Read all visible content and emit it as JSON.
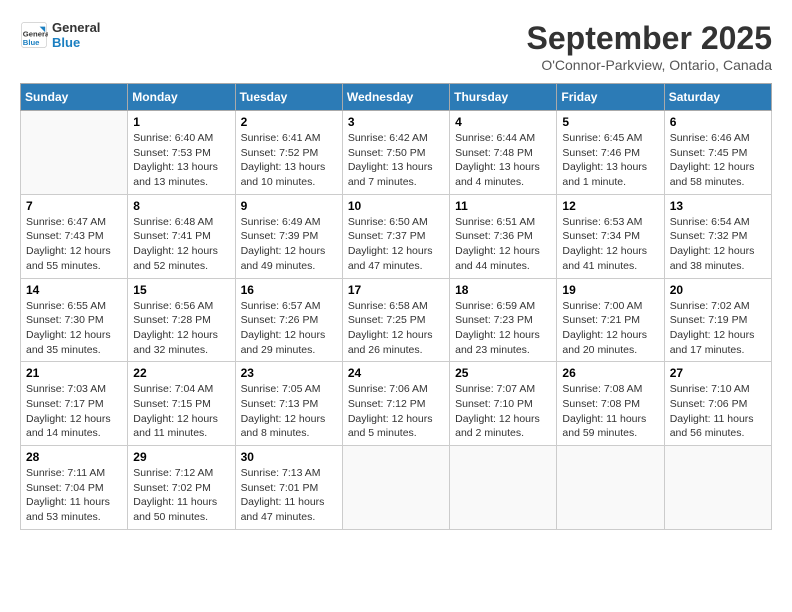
{
  "header": {
    "logo_line1": "General",
    "logo_line2": "Blue",
    "month_title": "September 2025",
    "subtitle": "O'Connor-Parkview, Ontario, Canada"
  },
  "days_of_week": [
    "Sunday",
    "Monday",
    "Tuesday",
    "Wednesday",
    "Thursday",
    "Friday",
    "Saturday"
  ],
  "weeks": [
    [
      {
        "day": "",
        "info": ""
      },
      {
        "day": "1",
        "info": "Sunrise: 6:40 AM\nSunset: 7:53 PM\nDaylight: 13 hours\nand 13 minutes."
      },
      {
        "day": "2",
        "info": "Sunrise: 6:41 AM\nSunset: 7:52 PM\nDaylight: 13 hours\nand 10 minutes."
      },
      {
        "day": "3",
        "info": "Sunrise: 6:42 AM\nSunset: 7:50 PM\nDaylight: 13 hours\nand 7 minutes."
      },
      {
        "day": "4",
        "info": "Sunrise: 6:44 AM\nSunset: 7:48 PM\nDaylight: 13 hours\nand 4 minutes."
      },
      {
        "day": "5",
        "info": "Sunrise: 6:45 AM\nSunset: 7:46 PM\nDaylight: 13 hours\nand 1 minute."
      },
      {
        "day": "6",
        "info": "Sunrise: 6:46 AM\nSunset: 7:45 PM\nDaylight: 12 hours\nand 58 minutes."
      }
    ],
    [
      {
        "day": "7",
        "info": "Sunrise: 6:47 AM\nSunset: 7:43 PM\nDaylight: 12 hours\nand 55 minutes."
      },
      {
        "day": "8",
        "info": "Sunrise: 6:48 AM\nSunset: 7:41 PM\nDaylight: 12 hours\nand 52 minutes."
      },
      {
        "day": "9",
        "info": "Sunrise: 6:49 AM\nSunset: 7:39 PM\nDaylight: 12 hours\nand 49 minutes."
      },
      {
        "day": "10",
        "info": "Sunrise: 6:50 AM\nSunset: 7:37 PM\nDaylight: 12 hours\nand 47 minutes."
      },
      {
        "day": "11",
        "info": "Sunrise: 6:51 AM\nSunset: 7:36 PM\nDaylight: 12 hours\nand 44 minutes."
      },
      {
        "day": "12",
        "info": "Sunrise: 6:53 AM\nSunset: 7:34 PM\nDaylight: 12 hours\nand 41 minutes."
      },
      {
        "day": "13",
        "info": "Sunrise: 6:54 AM\nSunset: 7:32 PM\nDaylight: 12 hours\nand 38 minutes."
      }
    ],
    [
      {
        "day": "14",
        "info": "Sunrise: 6:55 AM\nSunset: 7:30 PM\nDaylight: 12 hours\nand 35 minutes."
      },
      {
        "day": "15",
        "info": "Sunrise: 6:56 AM\nSunset: 7:28 PM\nDaylight: 12 hours\nand 32 minutes."
      },
      {
        "day": "16",
        "info": "Sunrise: 6:57 AM\nSunset: 7:26 PM\nDaylight: 12 hours\nand 29 minutes."
      },
      {
        "day": "17",
        "info": "Sunrise: 6:58 AM\nSunset: 7:25 PM\nDaylight: 12 hours\nand 26 minutes."
      },
      {
        "day": "18",
        "info": "Sunrise: 6:59 AM\nSunset: 7:23 PM\nDaylight: 12 hours\nand 23 minutes."
      },
      {
        "day": "19",
        "info": "Sunrise: 7:00 AM\nSunset: 7:21 PM\nDaylight: 12 hours\nand 20 minutes."
      },
      {
        "day": "20",
        "info": "Sunrise: 7:02 AM\nSunset: 7:19 PM\nDaylight: 12 hours\nand 17 minutes."
      }
    ],
    [
      {
        "day": "21",
        "info": "Sunrise: 7:03 AM\nSunset: 7:17 PM\nDaylight: 12 hours\nand 14 minutes."
      },
      {
        "day": "22",
        "info": "Sunrise: 7:04 AM\nSunset: 7:15 PM\nDaylight: 12 hours\nand 11 minutes."
      },
      {
        "day": "23",
        "info": "Sunrise: 7:05 AM\nSunset: 7:13 PM\nDaylight: 12 hours\nand 8 minutes."
      },
      {
        "day": "24",
        "info": "Sunrise: 7:06 AM\nSunset: 7:12 PM\nDaylight: 12 hours\nand 5 minutes."
      },
      {
        "day": "25",
        "info": "Sunrise: 7:07 AM\nSunset: 7:10 PM\nDaylight: 12 hours\nand 2 minutes."
      },
      {
        "day": "26",
        "info": "Sunrise: 7:08 AM\nSunset: 7:08 PM\nDaylight: 11 hours\nand 59 minutes."
      },
      {
        "day": "27",
        "info": "Sunrise: 7:10 AM\nSunset: 7:06 PM\nDaylight: 11 hours\nand 56 minutes."
      }
    ],
    [
      {
        "day": "28",
        "info": "Sunrise: 7:11 AM\nSunset: 7:04 PM\nDaylight: 11 hours\nand 53 minutes."
      },
      {
        "day": "29",
        "info": "Sunrise: 7:12 AM\nSunset: 7:02 PM\nDaylight: 11 hours\nand 50 minutes."
      },
      {
        "day": "30",
        "info": "Sunrise: 7:13 AM\nSunset: 7:01 PM\nDaylight: 11 hours\nand 47 minutes."
      },
      {
        "day": "",
        "info": ""
      },
      {
        "day": "",
        "info": ""
      },
      {
        "day": "",
        "info": ""
      },
      {
        "day": "",
        "info": ""
      }
    ]
  ]
}
